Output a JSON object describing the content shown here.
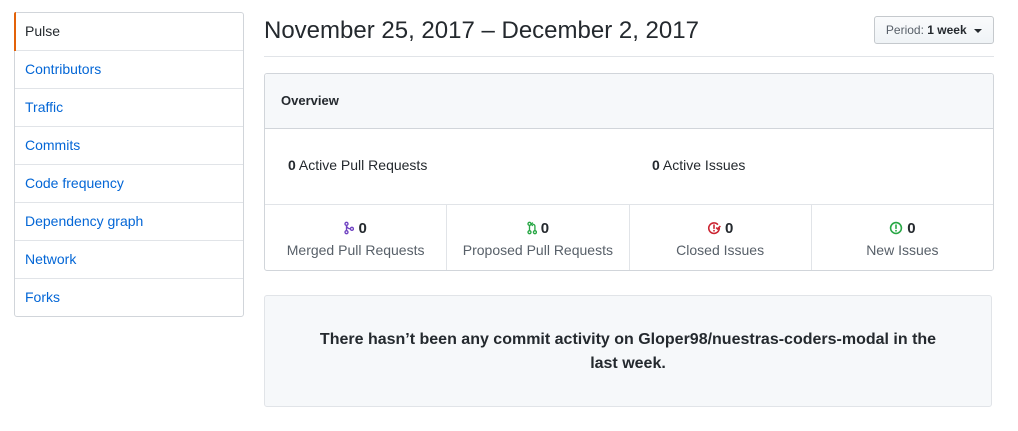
{
  "sidebar": {
    "items": [
      {
        "label": "Pulse"
      },
      {
        "label": "Contributors"
      },
      {
        "label": "Traffic"
      },
      {
        "label": "Commits"
      },
      {
        "label": "Code frequency"
      },
      {
        "label": "Dependency graph"
      },
      {
        "label": "Network"
      },
      {
        "label": "Forks"
      }
    ]
  },
  "header": {
    "date_range": "November 25, 2017 – December 2, 2017",
    "period_prefix": "Period:",
    "period_value": "1 week"
  },
  "overview": {
    "title": "Overview",
    "active_prs": {
      "count": "0",
      "label": "Active Pull Requests"
    },
    "active_issues": {
      "count": "0",
      "label": "Active Issues"
    },
    "counts": [
      {
        "icon": "git-merge-icon",
        "color": "#6f42c1",
        "count": "0",
        "label": "Merged Pull Requests"
      },
      {
        "icon": "git-pull-request-icon",
        "color": "#28a745",
        "count": "0",
        "label": "Proposed Pull Requests"
      },
      {
        "icon": "issue-closed-icon",
        "color": "#cb2431",
        "count": "0",
        "label": "Closed Issues"
      },
      {
        "icon": "issue-opened-icon",
        "color": "#28a745",
        "count": "0",
        "label": "New Issues"
      }
    ]
  },
  "commit_activity": {
    "message": "There hasn’t been any commit activity on Gloper98/nuestras-coders-modal in the last week."
  }
}
